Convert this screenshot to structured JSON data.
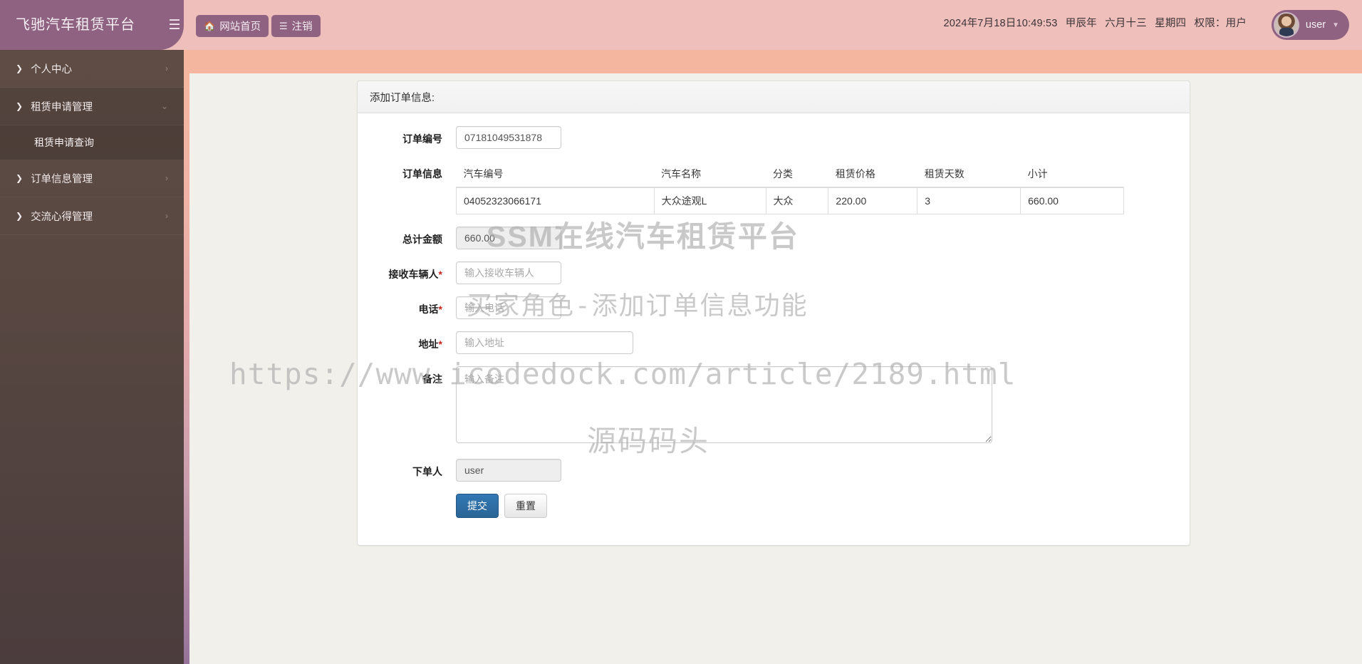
{
  "header": {
    "brand": "飞驰汽车租赁平台",
    "toggle_icon": "hamburger-icon",
    "buttons": [
      {
        "label": "网站首页",
        "icon": "home-icon"
      },
      {
        "label": "注销",
        "icon": "bars-icon"
      }
    ],
    "status": {
      "datetime": "2024年7月18日10:49:53",
      "ganzhi_year": "甲辰年",
      "lunar_date": "六月十三",
      "weekday": "星期四",
      "role": "权限：用户"
    },
    "user": {
      "name": "user",
      "caret": "▼"
    }
  },
  "sidebar": {
    "items": [
      {
        "label": "个人中心",
        "expanded": false,
        "chevron": "›"
      },
      {
        "label": "租赁申请管理",
        "expanded": true,
        "chevron": "⌄"
      },
      {
        "label": "订单信息管理",
        "expanded": false,
        "chevron": "›"
      },
      {
        "label": "交流心得管理",
        "expanded": false,
        "chevron": "›"
      }
    ],
    "submenu_label": "租赁申请查询"
  },
  "panel": {
    "title": "添加订单信息:",
    "fields": {
      "order_no_label": "订单编号",
      "order_no_value": "07181049531878",
      "order_info_label": "订单信息",
      "total_label": "总计金额",
      "total_value": "660.00",
      "receiver_label": "接收车辆人",
      "receiver_placeholder": "输入接收车辆人",
      "phone_label": "电话",
      "phone_placeholder": "输入电话",
      "address_label": "地址",
      "address_placeholder": "输入地址",
      "remark_label": "备注",
      "remark_placeholder": "输入备注",
      "orderer_label": "下单人",
      "orderer_value": "user",
      "required_mark": "*"
    },
    "table": {
      "headers": [
        "汽车编号",
        "汽车名称",
        "分类",
        "租赁价格",
        "租赁天数",
        "小计"
      ],
      "rows": [
        [
          "04052323066171",
          "大众途观L",
          "大众",
          "220.00",
          "3",
          "660.00"
        ]
      ]
    },
    "buttons": {
      "submit": "提交",
      "reset": "重置"
    }
  },
  "watermarks": {
    "line1": "SSM在线汽车租赁平台",
    "line2": "买家角色-添加订单信息功能",
    "line3": "https://www.icodedock.com/article/2189.html",
    "line4": "源码码头"
  },
  "colors": {
    "brand_purple": "#8f6281",
    "topbar_pink": "#efc0bb",
    "sidebar_brown": "#5e4c45",
    "submit_blue": "#2a6496",
    "required_red": "#c3241b",
    "content_bg": "#f1f0ea"
  }
}
